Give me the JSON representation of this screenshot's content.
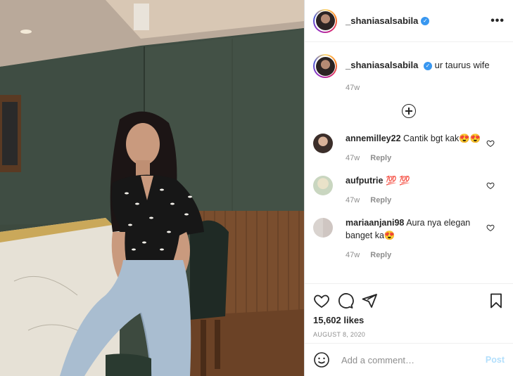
{
  "post": {
    "username": "_shaniasalsabila",
    "verified": true,
    "more_label": "•••"
  },
  "caption": {
    "username": "_shaniasalsabila",
    "text": "ur taurus wife",
    "age": "47w"
  },
  "comments": [
    {
      "username": "annemilley22",
      "text": "Cantik bgt kak😍😍",
      "age": "47w",
      "reply": "Reply"
    },
    {
      "username": "aufputrie",
      "text": "💯 💯",
      "age": "47w",
      "reply": "Reply"
    },
    {
      "username": "mariaanjani98",
      "text": "Aura nya elegan banget ka😍",
      "age": "47w",
      "reply": "Reply"
    }
  ],
  "actions": {
    "likes": "15,602 likes",
    "date": "AUGUST 8, 2020"
  },
  "add_comment": {
    "placeholder": "Add a comment…",
    "post_label": "Post"
  },
  "colors": {
    "verified_blue": "#3897f0",
    "post_disabled": "#b2dffc",
    "meta_gray": "#8e8e8e"
  }
}
